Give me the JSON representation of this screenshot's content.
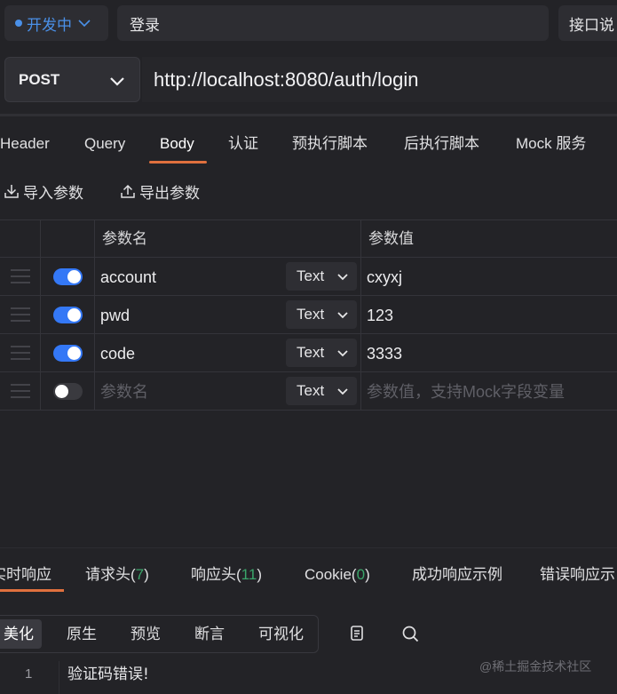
{
  "header": {
    "env_label": "开发中",
    "api_name": "登录",
    "doc_button": "接口说"
  },
  "request": {
    "method": "POST",
    "url": "http://localhost:8080/auth/login"
  },
  "req_tabs": [
    "Header",
    "Query",
    "Body",
    "认证",
    "预执行脚本",
    "后执行脚本",
    "Mock 服务"
  ],
  "active_req_tab": "Body",
  "actions": {
    "import": "导入参数",
    "export": "导出参数"
  },
  "params_table": {
    "columns": [
      "参数名",
      "参数值"
    ],
    "rows": [
      {
        "enabled": true,
        "name": "account",
        "type": "Text",
        "value": "cxyxj"
      },
      {
        "enabled": true,
        "name": "pwd",
        "type": "Text",
        "value": "123"
      },
      {
        "enabled": true,
        "name": "code",
        "type": "Text",
        "value": "3333"
      }
    ],
    "new_row": {
      "enabled": false,
      "name_placeholder": "参数名",
      "type": "Text",
      "value_placeholder": "参数值，支持Mock字段变量"
    }
  },
  "response_tabs": [
    {
      "label": "实时响应"
    },
    {
      "label": "请求头",
      "count": "7"
    },
    {
      "label": "响应头",
      "count": "11"
    },
    {
      "label": "Cookie",
      "count": "0"
    },
    {
      "label": "成功响应示例"
    },
    {
      "label": "错误响应示"
    }
  ],
  "view_modes": [
    "美化",
    "原生",
    "预览",
    "断言",
    "可视化"
  ],
  "active_view_mode": "美化",
  "editor": {
    "line_number": "1",
    "content": "验证码错误!"
  },
  "watermark": "@稀土掘金技术社区",
  "colors": {
    "accent_orange": "#e0703e",
    "toggle_blue": "#3478f6",
    "env_blue": "#4a90e8",
    "count_green": "#3aa66a"
  }
}
